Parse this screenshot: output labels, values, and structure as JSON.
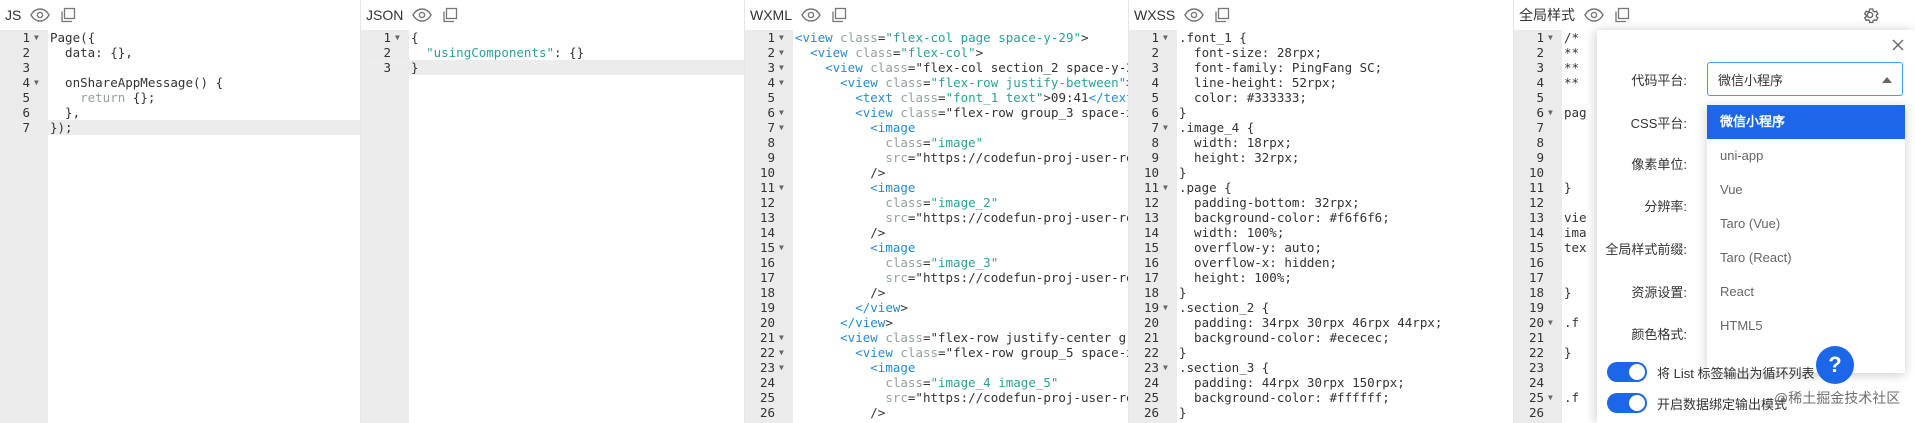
{
  "panes": [
    {
      "title": "JS",
      "lines": [
        {
          "n": "1",
          "fold": true,
          "code": "Page({"
        },
        {
          "n": "2",
          "code": "  data: {},"
        },
        {
          "n": "3",
          "code": ""
        },
        {
          "n": "4",
          "fold": true,
          "code": "  onShareAppMessage() {"
        },
        {
          "n": "5",
          "code": "    return {};",
          "tokens": [
            {
              "t": "k",
              "v": "    return "
            },
            {
              "t": "n",
              "v": "{};"
            }
          ]
        },
        {
          "n": "6",
          "code": "  },"
        },
        {
          "n": "7",
          "code": "});",
          "active": true
        }
      ]
    },
    {
      "title": "JSON",
      "lines": [
        {
          "n": "1",
          "fold": true,
          "code": "{"
        },
        {
          "n": "2",
          "code": "  \"usingComponents\": {}",
          "tokens": [
            {
              "t": "n",
              "v": "  "
            },
            {
              "t": "s",
              "v": "\"usingComponents\""
            },
            {
              "t": "n",
              "v": ": {}"
            }
          ]
        },
        {
          "n": "3",
          "code": "}",
          "active": true
        }
      ]
    },
    {
      "title": "WXML",
      "lines": [
        {
          "n": "1",
          "fold": true,
          "code": "<view class=\"flex-col page space-y-29\">"
        },
        {
          "n": "2",
          "fold": true,
          "code": "  <view class=\"flex-col\">"
        },
        {
          "n": "3",
          "fold": true,
          "code": "    <view class=\"flex-col section_2 space-y-2"
        },
        {
          "n": "4",
          "fold": true,
          "code": "      <view class=\"flex-row justify-between\">"
        },
        {
          "n": "5",
          "code": "        <text class=\"font_1 text\">09:41</text"
        },
        {
          "n": "6",
          "fold": true,
          "code": "        <view class=\"flex-row group_3 space-x"
        },
        {
          "n": "7",
          "fold": true,
          "code": "          <image"
        },
        {
          "n": "8",
          "code": "            class=\"image\""
        },
        {
          "n": "9",
          "code": "            src=\"https://codefun-proj-user-re"
        },
        {
          "n": "10",
          "code": "          />"
        },
        {
          "n": "11",
          "fold": true,
          "code": "          <image"
        },
        {
          "n": "12",
          "code": "            class=\"image_2\""
        },
        {
          "n": "13",
          "code": "            src=\"https://codefun-proj-user-re"
        },
        {
          "n": "14",
          "code": "          />"
        },
        {
          "n": "15",
          "fold": true,
          "code": "          <image"
        },
        {
          "n": "16",
          "code": "            class=\"image_3\""
        },
        {
          "n": "17",
          "code": "            src=\"https://codefun-proj-user-re"
        },
        {
          "n": "18",
          "code": "          />"
        },
        {
          "n": "19",
          "code": "        </view>"
        },
        {
          "n": "20",
          "code": "      </view>"
        },
        {
          "n": "21",
          "fold": true,
          "code": "      <view class=\"flex-row justify-center gr"
        },
        {
          "n": "22",
          "fold": true,
          "code": "        <view class=\"flex-row group_5 space-x"
        },
        {
          "n": "23",
          "fold": true,
          "code": "          <image"
        },
        {
          "n": "24",
          "code": "            class=\"image_4 image_5\""
        },
        {
          "n": "25",
          "code": "            src=\"https://codefun-proj-user-re"
        },
        {
          "n": "26",
          "code": "          />"
        }
      ]
    },
    {
      "title": "WXSS",
      "lines": [
        {
          "n": "1",
          "fold": true,
          "code": ".font_1 {"
        },
        {
          "n": "2",
          "code": "  font-size: 28rpx;"
        },
        {
          "n": "3",
          "code": "  font-family: PingFang SC;"
        },
        {
          "n": "4",
          "code": "  line-height: 52rpx;"
        },
        {
          "n": "5",
          "code": "  color: #333333;"
        },
        {
          "n": "6",
          "code": "}"
        },
        {
          "n": "7",
          "fold": true,
          "code": ".image_4 {"
        },
        {
          "n": "8",
          "code": "  width: 18rpx;"
        },
        {
          "n": "9",
          "code": "  height: 32rpx;"
        },
        {
          "n": "10",
          "code": "}"
        },
        {
          "n": "11",
          "fold": true,
          "code": ".page {"
        },
        {
          "n": "12",
          "code": "  padding-bottom: 32rpx;"
        },
        {
          "n": "13",
          "code": "  background-color: #f6f6f6;"
        },
        {
          "n": "14",
          "code": "  width: 100%;"
        },
        {
          "n": "15",
          "code": "  overflow-y: auto;"
        },
        {
          "n": "16",
          "code": "  overflow-x: hidden;"
        },
        {
          "n": "17",
          "code": "  height: 100%;"
        },
        {
          "n": "18",
          "code": "}"
        },
        {
          "n": "19",
          "fold": true,
          "code": ".section_2 {"
        },
        {
          "n": "20",
          "code": "  padding: 34rpx 30rpx 46rpx 44rpx;"
        },
        {
          "n": "21",
          "code": "  background-color: #ececec;"
        },
        {
          "n": "22",
          "code": "}"
        },
        {
          "n": "23",
          "fold": true,
          "code": ".section_3 {"
        },
        {
          "n": "24",
          "code": "  padding: 44rpx 30rpx 150rpx;"
        },
        {
          "n": "25",
          "code": "  background-color: #ffffff;"
        },
        {
          "n": "26",
          "code": "}"
        }
      ]
    },
    {
      "title": "全局样式",
      "lines": [
        {
          "n": "1",
          "fold": true,
          "code": "/*"
        },
        {
          "n": "2",
          "code": "**"
        },
        {
          "n": "3",
          "code": "**"
        },
        {
          "n": "4",
          "code": "**"
        },
        {
          "n": "5",
          "code": ""
        },
        {
          "n": "6",
          "fold": true,
          "code": "pag"
        },
        {
          "n": "7",
          "code": "  "
        },
        {
          "n": "8",
          "code": "  "
        },
        {
          "n": "9",
          "code": "  "
        },
        {
          "n": "10",
          "code": ""
        },
        {
          "n": "11",
          "code": "}"
        },
        {
          "n": "12",
          "code": ""
        },
        {
          "n": "13",
          "code": "vie"
        },
        {
          "n": "14",
          "code": "ima"
        },
        {
          "n": "15",
          "code": "tex"
        },
        {
          "n": "16",
          "code": "  "
        },
        {
          "n": "17",
          "code": "  "
        },
        {
          "n": "18",
          "code": "}"
        },
        {
          "n": "19",
          "code": ""
        },
        {
          "n": "20",
          "fold": true,
          "code": ".f"
        },
        {
          "n": "21",
          "code": "  "
        },
        {
          "n": "22",
          "code": "}"
        },
        {
          "n": "23",
          "code": ""
        },
        {
          "n": "24",
          "code": ""
        },
        {
          "n": "25",
          "fold": true,
          "code": ".f"
        },
        {
          "n": "26",
          "code": "  "
        }
      ]
    }
  ],
  "settings": {
    "labels": {
      "platform": "代码平台:",
      "css_platform": "CSS平台:",
      "pixel_unit": "像素单位:",
      "resolution": "分辨率:",
      "global_prefix": "全局样式前缀:",
      "resource": "资源设置:",
      "color_format": "颜色格式:"
    },
    "platform_value": "微信小程序",
    "platform_options": [
      "微信小程序",
      "uni-app",
      "Vue",
      "Taro (Vue)",
      "Taro (React)",
      "React",
      "HTML5"
    ],
    "toggle_list_label": "将 List 标签输出为循环列表",
    "toggle_binding_label": "开启数据绑定输出模式",
    "help": "?"
  },
  "watermark": "@稀土掘金技术社区",
  "colors": {
    "accent": "#1b67e8",
    "focus": "#409eff",
    "gutter": "#ebebeb"
  },
  "icons": [
    "eye-icon",
    "copy-icon",
    "gear-icon",
    "close-icon"
  ]
}
